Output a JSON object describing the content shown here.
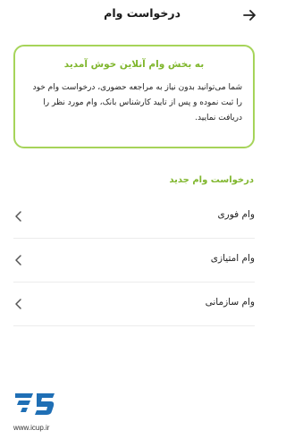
{
  "header": {
    "title": "درخواست وام",
    "back_icon": "arrow-right-icon"
  },
  "welcome": {
    "title": "به بخش وام آنلاین خوش آمدید",
    "body": "شما می‌توانید بدون نیاز به مراجعه حضوری، درخواست وام خود را ثبت نموده و پس از تایید کارشناس بانک، وام مورد نظر را دریافت نمایید.",
    "border_color": "#a6d45a",
    "title_color": "#7fb62c"
  },
  "section": {
    "title": "درخواست وام جدید"
  },
  "loan_types": [
    {
      "label": "وام فوری",
      "icon": "chevron-left-icon"
    },
    {
      "label": "وام امتیازی",
      "icon": "chevron-left-icon"
    },
    {
      "label": "وام سازمانی",
      "icon": "chevron-left-icon"
    }
  ],
  "watermark": {
    "site": "www.icup.ir",
    "color": "#1f6fb5"
  }
}
